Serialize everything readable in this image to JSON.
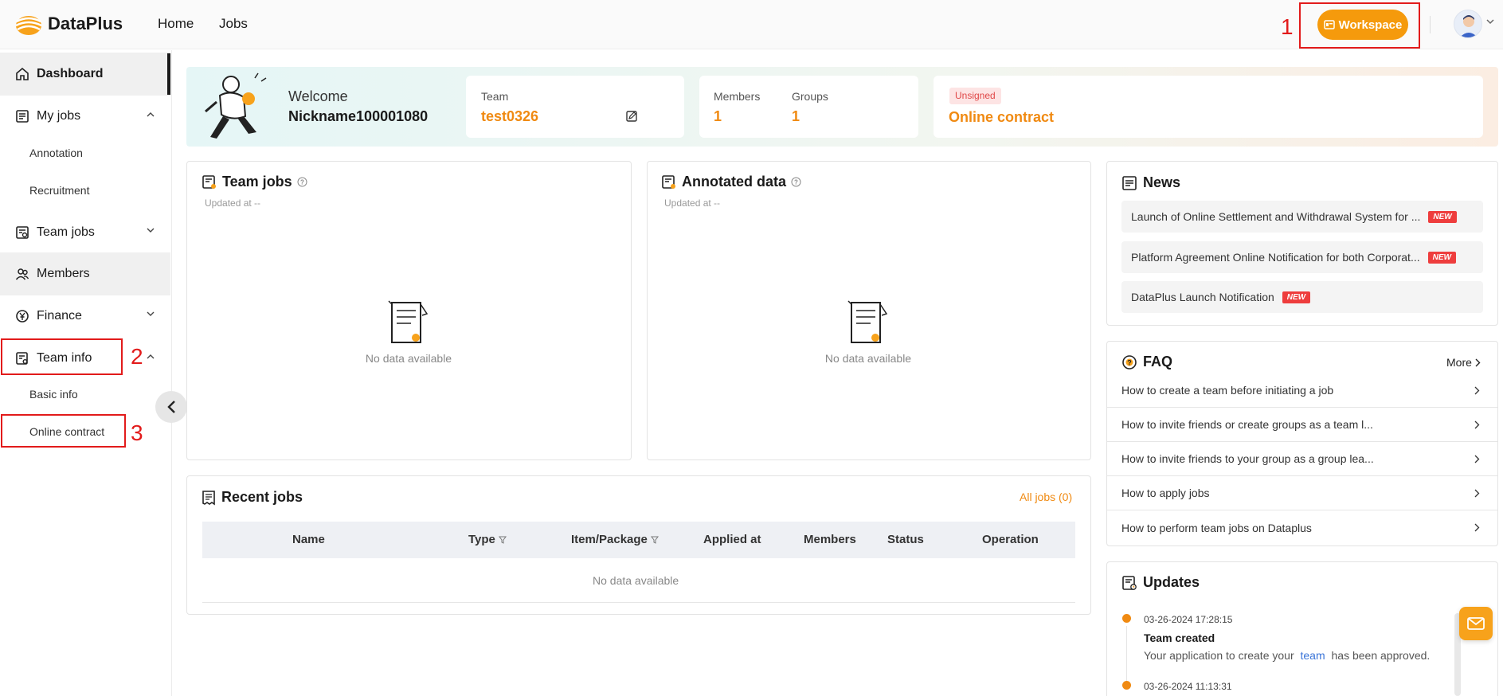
{
  "header": {
    "logo_text": "DataPlus",
    "nav": [
      {
        "label": "Home"
      },
      {
        "label": "Jobs"
      }
    ],
    "workspace_label": "Workspace"
  },
  "annotations": [
    "1",
    "2",
    "3"
  ],
  "sidebar": {
    "dashboard": "Dashboard",
    "my_jobs": "My jobs",
    "my_jobs_children": [
      "Annotation",
      "Recruitment"
    ],
    "team_jobs": "Team jobs",
    "members": "Members",
    "finance": "Finance",
    "team_info": "Team info",
    "team_info_children": [
      "Basic info",
      "Online contract"
    ]
  },
  "banner": {
    "welcome": "Welcome",
    "nickname": "Nickname100001080",
    "team_label": "Team",
    "team_value": "test0326",
    "members_label": "Members",
    "members_value": "1",
    "groups_label": "Groups",
    "groups_value": "1",
    "contract_badge": "Unsigned",
    "contract_label": "Online contract"
  },
  "team_jobs_panel": {
    "title": "Team jobs",
    "updated": "Updated at --",
    "empty": "No data available"
  },
  "annotated_panel": {
    "title": "Annotated data",
    "updated": "Updated at --",
    "empty": "No data available"
  },
  "recent_jobs": {
    "title": "Recent jobs",
    "all_link": "All jobs (0)",
    "columns": [
      "Name",
      "Type",
      "Item/Package",
      "Applied at",
      "Members",
      "Status",
      "Operation"
    ],
    "empty": "No data available"
  },
  "news": {
    "title": "News",
    "items": [
      {
        "text": "Launch of Online Settlement and Withdrawal System for ...",
        "badge": "NEW"
      },
      {
        "text": "Platform Agreement Online Notification for both Corporat...",
        "badge": "NEW"
      },
      {
        "text": "DataPlus Launch Notification",
        "badge": "NEW"
      }
    ]
  },
  "faq": {
    "title": "FAQ",
    "more": "More",
    "items": [
      "How to create a team before initiating a job",
      "How to invite friends or create groups as a team l...",
      "How to invite friends to your group as a group lea...",
      "How to apply jobs",
      "How to perform team jobs on Dataplus"
    ]
  },
  "updates": {
    "title": "Updates",
    "entries": [
      {
        "time": "03-26-2024 17:28:15",
        "title": "Team created",
        "desc_before": "Your application to create your",
        "desc_link": "team",
        "desc_after": "has been approved."
      },
      {
        "time": "03-26-2024 11:13:31"
      }
    ]
  },
  "colors": {
    "accent": "#f08a12",
    "workspace": "#f59a0c",
    "annotation": "#e21b1b",
    "new_badge": "#ee3d3d"
  }
}
